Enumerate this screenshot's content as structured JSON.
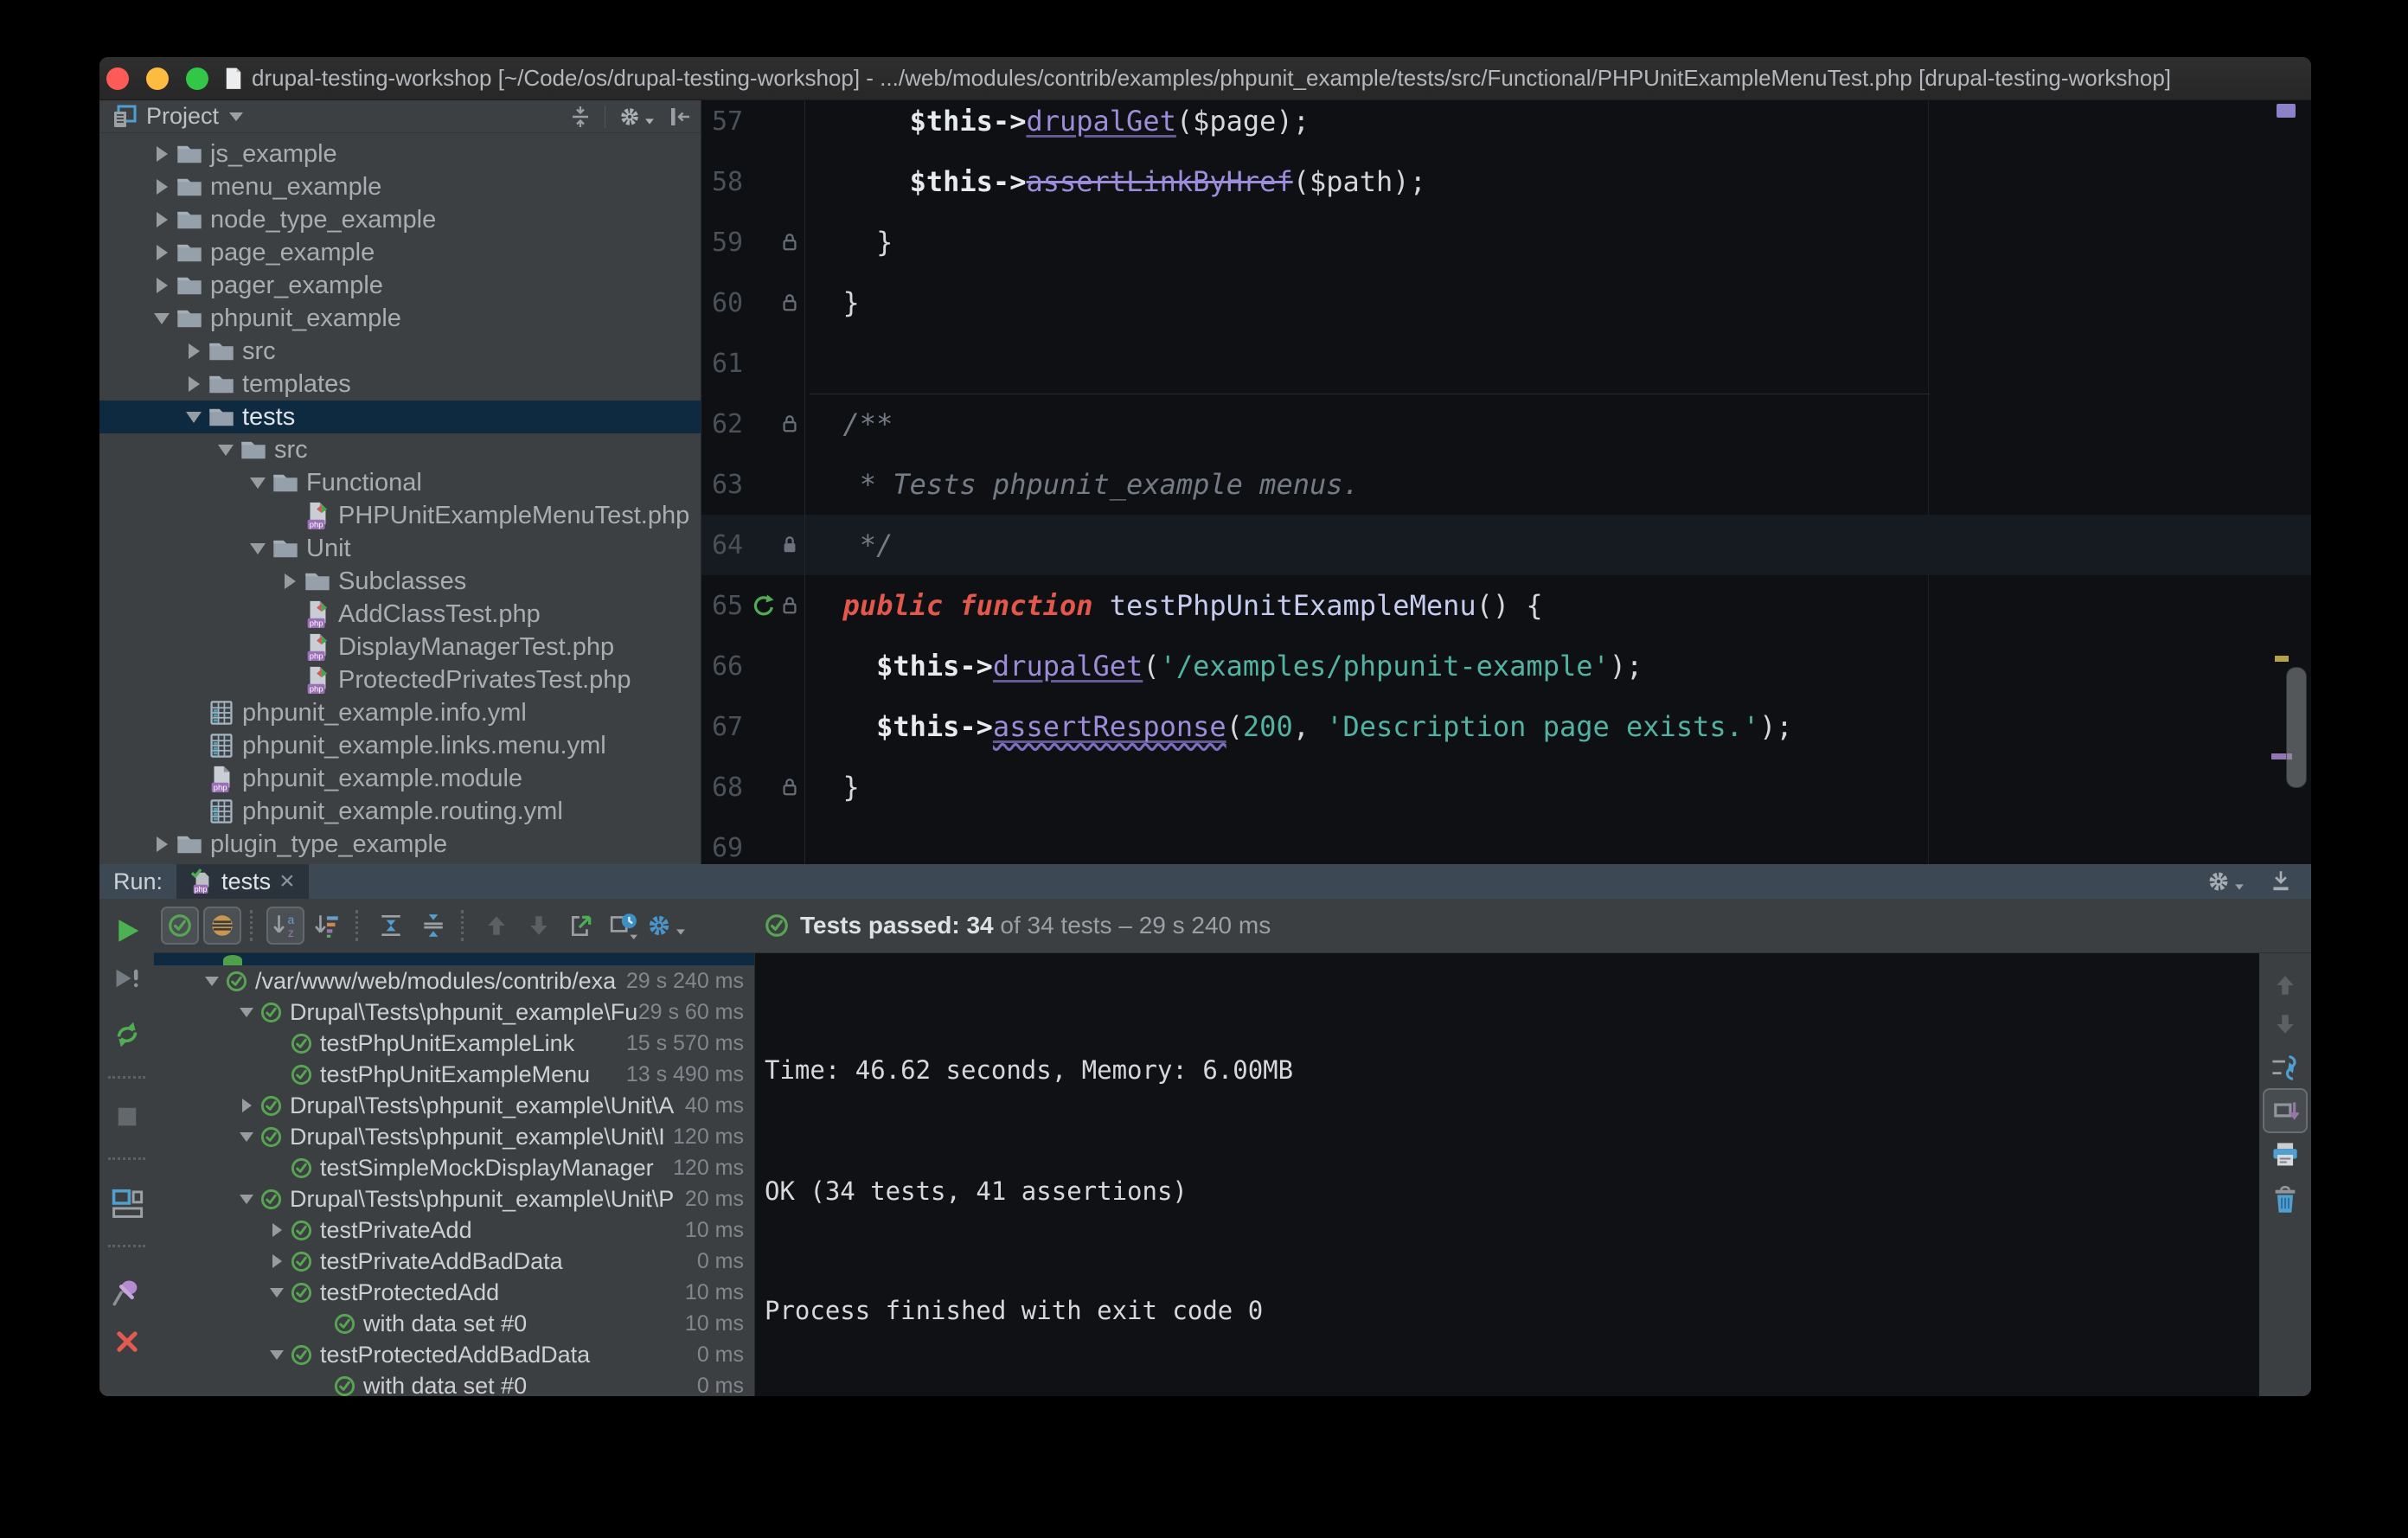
{
  "title_bar": {
    "title": "drupal-testing-workshop [~/Code/os/drupal-testing-workshop] - .../web/modules/contrib/examples/phpunit_example/tests/src/Functional/PHPUnitExampleMenuTest.php [drupal-testing-workshop]"
  },
  "project_panel": {
    "title": "Project",
    "items": [
      {
        "label": "js_example",
        "type": "folder",
        "state": "collapsed"
      },
      {
        "label": "menu_example",
        "type": "folder",
        "state": "collapsed"
      },
      {
        "label": "node_type_example",
        "type": "folder",
        "state": "collapsed"
      },
      {
        "label": "page_example",
        "type": "folder",
        "state": "collapsed"
      },
      {
        "label": "pager_example",
        "type": "folder",
        "state": "collapsed"
      },
      {
        "label": "phpunit_example",
        "type": "folder",
        "state": "expanded"
      },
      {
        "label": "src",
        "type": "folder",
        "state": "collapsed"
      },
      {
        "label": "templates",
        "type": "folder",
        "state": "collapsed"
      },
      {
        "label": "tests",
        "type": "folder",
        "state": "expanded",
        "selected": true
      },
      {
        "label": "src",
        "type": "folder",
        "state": "expanded"
      },
      {
        "label": "Functional",
        "type": "folder",
        "state": "expanded"
      },
      {
        "label": "PHPUnitExampleMenuTest.php",
        "type": "php-file"
      },
      {
        "label": "Unit",
        "type": "folder",
        "state": "expanded"
      },
      {
        "label": "Subclasses",
        "type": "folder",
        "state": "collapsed"
      },
      {
        "label": "AddClassTest.php",
        "type": "php-file"
      },
      {
        "label": "DisplayManagerTest.php",
        "type": "php-file"
      },
      {
        "label": "ProtectedPrivatesTest.php",
        "type": "php-file"
      },
      {
        "label": "phpunit_example.info.yml",
        "type": "yml-file"
      },
      {
        "label": "phpunit_example.links.menu.yml",
        "type": "yml-file"
      },
      {
        "label": "phpunit_example.module",
        "type": "module-file"
      },
      {
        "label": "phpunit_example.routing.yml",
        "type": "yml-file"
      },
      {
        "label": "plugin_type_example",
        "type": "folder",
        "state": "collapsed"
      }
    ]
  },
  "editor": {
    "lines": [
      {
        "num": "57",
        "ind": "      ",
        "var": "$this->",
        "method": "drupalGet",
        "p1": "(",
        "plain": "$page",
        "p2": ");"
      },
      {
        "num": "58",
        "ind": "      ",
        "var": "$this->",
        "method": "assertLinkByHref",
        "p1": "(",
        "plain": "$path",
        "p2": ");"
      },
      {
        "num": "59",
        "plain": "    }"
      },
      {
        "num": "60",
        "plain": "  }"
      },
      {
        "num": "61"
      },
      {
        "num": "62",
        "comment": "  /**"
      },
      {
        "num": "63",
        "comment": "   * Tests phpunit_example menus."
      },
      {
        "num": "64",
        "comment": "   */"
      },
      {
        "num": "65",
        "ind": "  ",
        "kw": "public function ",
        "name": "testPhpUnitExampleMenu",
        "plain": "() {"
      },
      {
        "num": "66",
        "ind": "    ",
        "var": "$this->",
        "method": "drupalGet",
        "p1": "(",
        "str": "'/examples/phpunit-example'",
        "p2": ");"
      },
      {
        "num": "67",
        "ind": "    ",
        "var": "$this->",
        "method": "assertResponse",
        "p1": "(",
        "numv": "200",
        "comma": ", ",
        "str": "'Description page exists.'",
        "p2": ");"
      },
      {
        "num": "68",
        "plain": "  }"
      },
      {
        "num": "69"
      }
    ]
  },
  "run_panel": {
    "run_label": "Run:",
    "tab_label": "tests",
    "tab_close": "×",
    "status_main": "Tests passed: 34",
    "status_rest": " of 34 tests – 29 s 240 ms",
    "tree": [
      {
        "label": "/var/www/web/modules/contrib/exa",
        "time": "29 s 240 ms",
        "state": "expanded"
      },
      {
        "label": "Drupal\\Tests\\phpunit_example\\Fu",
        "time": "29 s 60 ms",
        "state": "expanded"
      },
      {
        "label": "testPhpUnitExampleLink",
        "time": "15 s 570 ms",
        "state": "leaf"
      },
      {
        "label": "testPhpUnitExampleMenu",
        "time": "13 s 490 ms",
        "state": "leaf"
      },
      {
        "label": "Drupal\\Tests\\phpunit_example\\Unit\\A",
        "time": "40 ms",
        "state": "collapsed"
      },
      {
        "label": "Drupal\\Tests\\phpunit_example\\Unit\\I",
        "time": "120 ms",
        "state": "expanded"
      },
      {
        "label": "testSimpleMockDisplayManager",
        "time": "120 ms",
        "state": "leaf"
      },
      {
        "label": "Drupal\\Tests\\phpunit_example\\Unit\\P",
        "time": "20 ms",
        "state": "expanded"
      },
      {
        "label": "testPrivateAdd",
        "time": "10 ms",
        "state": "collapsed"
      },
      {
        "label": "testPrivateAddBadData",
        "time": "0 ms",
        "state": "collapsed"
      },
      {
        "label": "testProtectedAdd",
        "time": "10 ms",
        "state": "expanded"
      },
      {
        "label": "with data set #0",
        "time": "10 ms",
        "state": "leaf"
      },
      {
        "label": "testProtectedAddBadData",
        "time": "0 ms",
        "state": "expanded"
      },
      {
        "label": "with data set #0",
        "time": "0 ms",
        "state": "leaf"
      }
    ],
    "console": {
      "line1": "Time: 46.62 seconds, Memory: 6.00MB",
      "line2": "OK (34 tests, 41 assertions)",
      "line3": "Process finished with exit code 0"
    }
  },
  "icons": {
    "php_badge": "php",
    "sort_a": "a",
    "sort_z": "z"
  }
}
